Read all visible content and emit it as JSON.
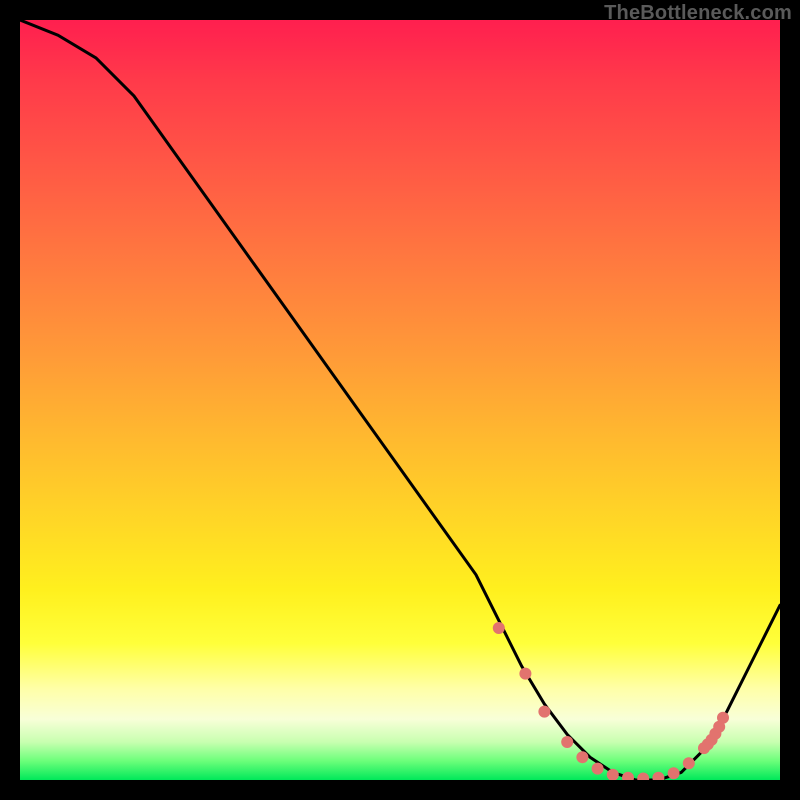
{
  "watermark": "TheBottleneck.com",
  "chart_data": {
    "type": "line",
    "title": "",
    "xlabel": "",
    "ylabel": "",
    "xlim": [
      0,
      100
    ],
    "ylim": [
      0,
      100
    ],
    "series": [
      {
        "name": "curve",
        "x": [
          0,
          5,
          10,
          15,
          20,
          25,
          30,
          35,
          40,
          45,
          50,
          55,
          60,
          63,
          66,
          69,
          72,
          75,
          78,
          81,
          84,
          87,
          90,
          93,
          96,
          100
        ],
        "values": [
          100,
          98,
          95,
          90,
          83,
          76,
          69,
          62,
          55,
          48,
          41,
          34,
          27,
          21,
          15,
          10,
          6,
          3,
          1,
          0,
          0,
          1,
          4,
          9,
          15,
          23
        ],
        "color": "#000000"
      }
    ],
    "markers": {
      "name": "highlight-dots",
      "color": "#e2736e",
      "x": [
        63,
        66.5,
        69,
        72,
        74,
        76,
        78,
        80,
        82,
        84,
        86,
        88,
        90,
        90.5,
        91,
        91.5,
        92,
        92.5
      ],
      "values": [
        20,
        14,
        9,
        5,
        3,
        1.5,
        0.7,
        0.3,
        0.2,
        0.3,
        0.9,
        2.2,
        4.2,
        4.7,
        5.3,
        6.1,
        7.0,
        8.2
      ]
    },
    "gradient_stops": [
      {
        "pos": 0,
        "color": "#ff1f4f"
      },
      {
        "pos": 50,
        "color": "#ff9a38"
      },
      {
        "pos": 80,
        "color": "#ffff3a"
      },
      {
        "pos": 95,
        "color": "#c8ffb0"
      },
      {
        "pos": 100,
        "color": "#00e85a"
      }
    ]
  }
}
